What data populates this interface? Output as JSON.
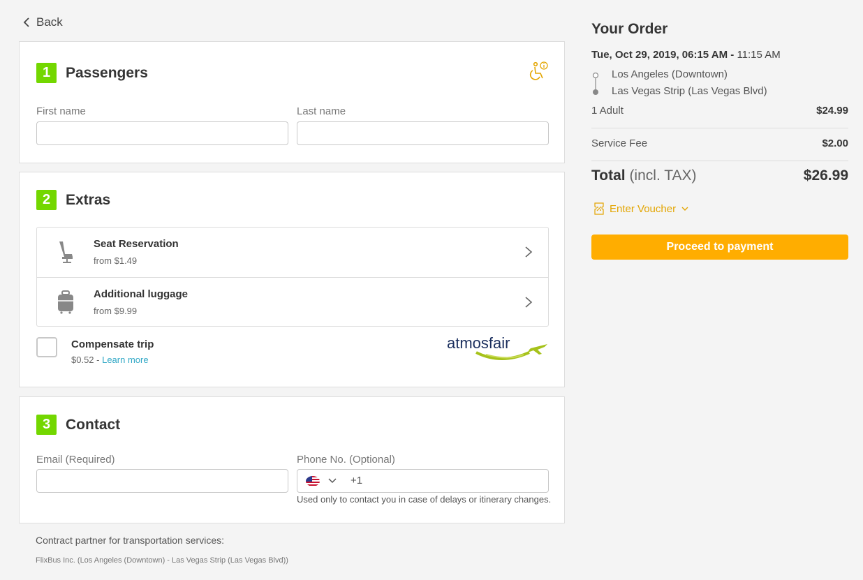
{
  "nav": {
    "back_label": "Back"
  },
  "passengers": {
    "step": "1",
    "title": "Passengers",
    "first_name_label": "First name",
    "last_name_label": "Last name",
    "first_name_value": "",
    "last_name_value": ""
  },
  "extras": {
    "step": "2",
    "title": "Extras",
    "items": [
      {
        "title": "Seat Reservation",
        "subtitle": "from $1.49",
        "icon": "seat-icon"
      },
      {
        "title": "Additional luggage",
        "subtitle": "from $9.99",
        "icon": "luggage-icon"
      }
    ],
    "compensate": {
      "title": "Compensate trip",
      "price": "$0.52 - ",
      "learn_more": "Learn more",
      "partner_logo": "atmosfair",
      "checked": false
    }
  },
  "contact": {
    "step": "3",
    "title": "Contact",
    "email_label": "Email (Required)",
    "phone_label": "Phone No. (Optional)",
    "phone_code": "+1",
    "phone_hint": "Used only to contact you in case of delays or itinerary changes."
  },
  "footer": {
    "contract_label": "Contract partner for transportation services:",
    "contract_value": "FlixBus Inc. (Los Angeles (Downtown) - Las Vegas Strip (Las Vegas Blvd))"
  },
  "order": {
    "title": "Your Order",
    "departure": "Tue, Oct 29, 2019, 06:15 AM",
    "separator": " - ",
    "arrival": "11:15 AM",
    "from": "Los Angeles (Downtown)",
    "to": "Las Vegas Strip (Las Vegas Blvd)",
    "lines": [
      {
        "label": "1 Adult",
        "amount": "$24.99"
      },
      {
        "label": "Service Fee",
        "amount": "$2.00"
      }
    ],
    "total_label": "Total",
    "total_suffix": " (incl. TAX)",
    "total_amount": "$26.99",
    "voucher_label": "Enter Voucher",
    "proceed_label": "Proceed to payment"
  },
  "colors": {
    "step_green": "#73d700",
    "proceed_orange": "#ffad00",
    "voucher_gold": "#e3a500",
    "link_blue": "#31a8c6"
  }
}
